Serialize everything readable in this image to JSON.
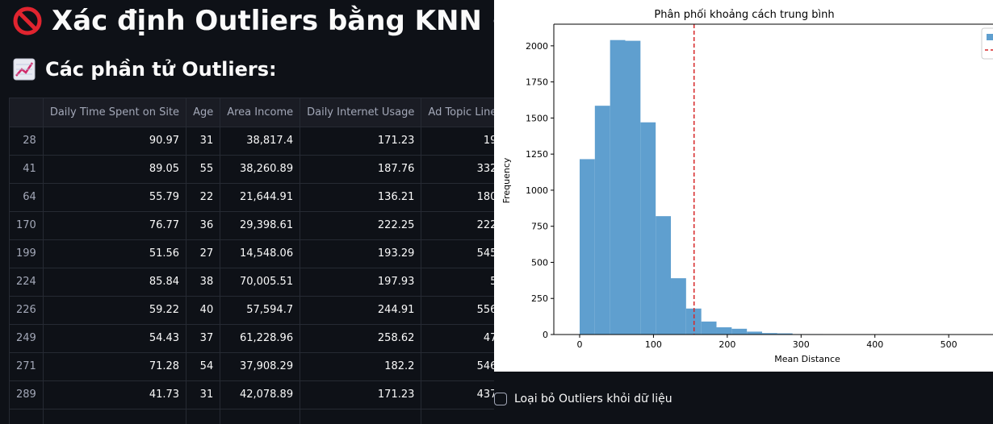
{
  "header": {
    "title": "Xác định Outliers bằng KNN",
    "subtitle": "Các phần tử Outliers:"
  },
  "icons": {
    "title_icon": "prohibited-icon",
    "title_link_icon": "link-icon",
    "subtitle_icon": "chart-increasing-icon"
  },
  "table": {
    "columns": [
      "",
      "Daily Time Spent on Site",
      "Age",
      "Area Income",
      "Daily Internet Usage",
      "Ad Topic Line"
    ],
    "rows": [
      [
        "28",
        "90.97",
        "31",
        "38,817.4",
        "171.23",
        "19"
      ],
      [
        "41",
        "89.05",
        "55",
        "38,260.89",
        "187.76",
        "332"
      ],
      [
        "64",
        "55.79",
        "22",
        "21,644.91",
        "136.21",
        "180"
      ],
      [
        "170",
        "76.77",
        "36",
        "29,398.61",
        "222.25",
        "222"
      ],
      [
        "199",
        "51.56",
        "27",
        "14,548.06",
        "193.29",
        "545"
      ],
      [
        "224",
        "85.84",
        "38",
        "70,005.51",
        "197.93",
        "5"
      ],
      [
        "226",
        "59.22",
        "40",
        "57,594.7",
        "244.91",
        "556"
      ],
      [
        "249",
        "54.43",
        "37",
        "61,228.96",
        "258.62",
        "47"
      ],
      [
        "271",
        "71.28",
        "54",
        "37,908.29",
        "182.2",
        "546"
      ],
      [
        "289",
        "41.73",
        "31",
        "42,078.89",
        "171.23",
        "437"
      ],
      [
        "",
        "",
        "",
        "",
        "",
        ""
      ]
    ]
  },
  "chart_data": {
    "type": "bar",
    "title": "Phân phối khoảng cách trung bình",
    "xlabel": "Mean Distance",
    "ylabel": "Frequency",
    "xlim": [
      -35,
      560
    ],
    "ylim": [
      0,
      2150
    ],
    "xticks": [
      0,
      100,
      200,
      300,
      400,
      500
    ],
    "yticks": [
      0,
      250,
      500,
      750,
      1000,
      1250,
      1500,
      1750,
      2000
    ],
    "bin_width": 20.6,
    "bins_start": 0,
    "values": [
      1215,
      1585,
      2040,
      2035,
      1470,
      820,
      390,
      180,
      90,
      50,
      40,
      20,
      10,
      8,
      3,
      3,
      2,
      1,
      1,
      1,
      1,
      0,
      1,
      0,
      1
    ],
    "threshold": 155,
    "colors": {
      "bar": "#5f9fcf",
      "threshold": "#d62728"
    },
    "legend_placement": "top-right"
  },
  "checkbox": {
    "label": "Loại bỏ Outliers khỏi dữ liệu",
    "checked": false
  }
}
